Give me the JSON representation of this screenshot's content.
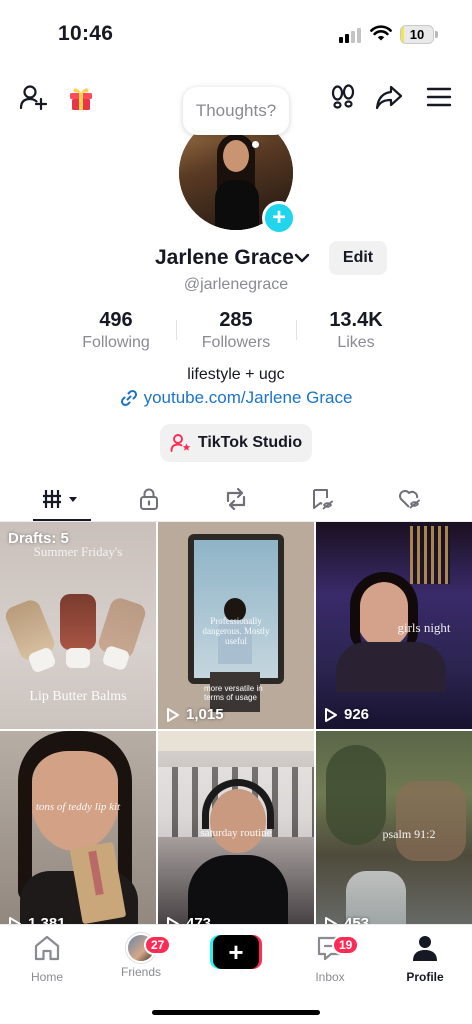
{
  "status_bar": {
    "time": "10:46",
    "battery": "10",
    "battery_level": 0.1
  },
  "header": {
    "thought_prompt": "Thoughts?"
  },
  "profile": {
    "name": "Jarlene Grace",
    "edit_label": "Edit",
    "handle": "@jarlenegrace",
    "stats": [
      {
        "value": "496",
        "label": "Following"
      },
      {
        "value": "285",
        "label": "Followers"
      },
      {
        "value": "13.4K",
        "label": "Likes"
      }
    ],
    "bio": "lifestyle + ugc",
    "link": "youtube.com/Jarlene Grace",
    "studio_label": "TikTok Studio"
  },
  "grid": {
    "drafts": "Drafts: 5",
    "videos": [
      {
        "caption_top": "Summer Friday's",
        "caption": "Lip Butter Balms",
        "views": ""
      },
      {
        "caption": "Professionally dangerous. Mostly useful",
        "sub": "more versatile in terms of usage",
        "views": "1,015"
      },
      {
        "caption": "girls night",
        "views": "926"
      },
      {
        "caption": "tons of teddy lip kit",
        "views": "1,381"
      },
      {
        "caption": "saturday routine",
        "views": "473"
      },
      {
        "caption": "psalm 91:2",
        "views": "453"
      }
    ]
  },
  "nav": {
    "items": [
      {
        "label": "Home"
      },
      {
        "label": "Friends",
        "badge": "27"
      },
      {
        "label": ""
      },
      {
        "label": "Inbox",
        "badge": "19"
      },
      {
        "label": "Profile"
      }
    ]
  },
  "colors": {
    "accent": "#20d5ec",
    "link": "#1b74c8",
    "badge": "#fe2c55"
  }
}
